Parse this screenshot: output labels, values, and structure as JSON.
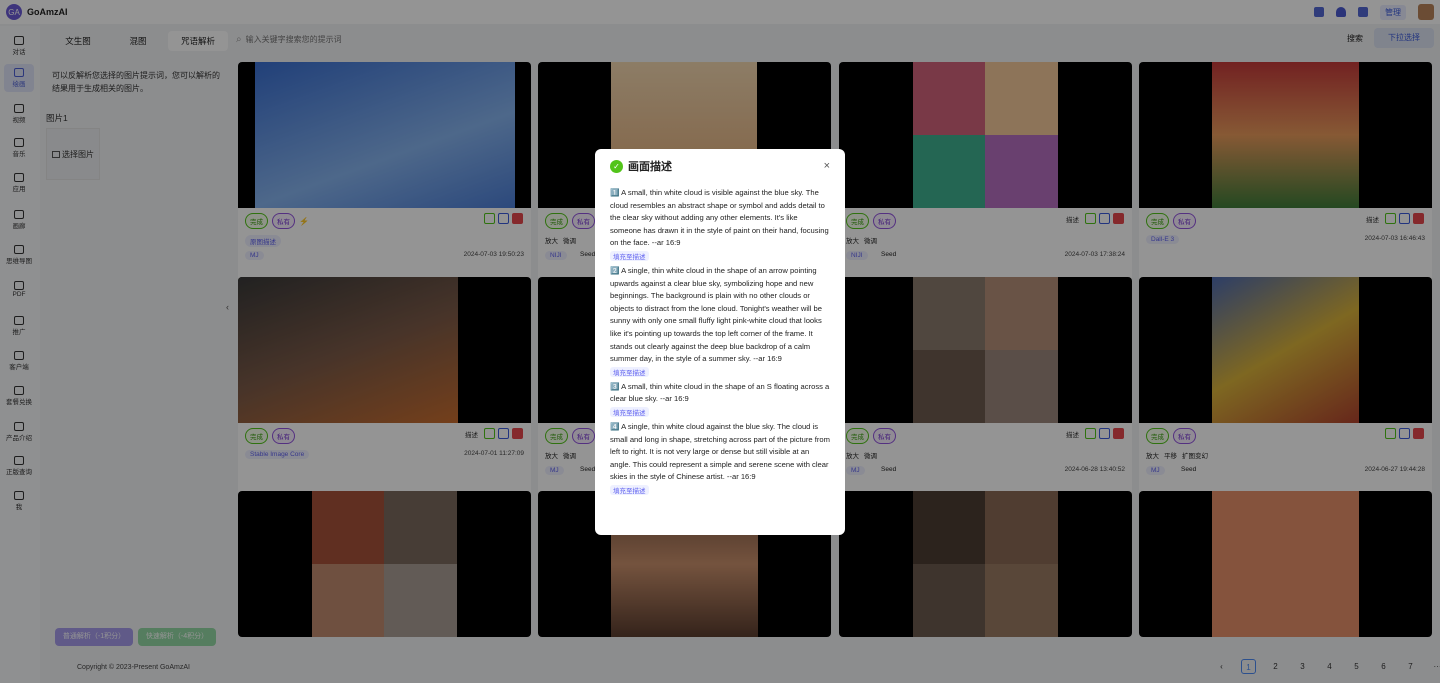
{
  "app": {
    "brand": "GoAmzAI",
    "logo_text": "GA",
    "manage_label": "管理"
  },
  "sidebar": {
    "items": [
      {
        "label": "对话",
        "icon": "chat-icon"
      },
      {
        "label": "绘画",
        "icon": "paint-icon",
        "active": true
      },
      {
        "label": "视频",
        "icon": "video-icon"
      },
      {
        "label": "音乐",
        "icon": "music-icon"
      },
      {
        "label": "应用",
        "icon": "app-icon"
      },
      {
        "label": "画廊",
        "icon": "gallery-icon"
      },
      {
        "label": "思维导图",
        "icon": "mindmap-icon"
      },
      {
        "label": "PDF",
        "icon": "pdf-icon"
      },
      {
        "label": "推广",
        "icon": "promote-icon"
      },
      {
        "label": "客户端",
        "icon": "client-icon"
      },
      {
        "label": "套餐兑换",
        "icon": "diamond-icon"
      },
      {
        "label": "产品介绍",
        "icon": "book-icon"
      },
      {
        "label": "正版查询",
        "icon": "verify-icon"
      },
      {
        "label": "我",
        "icon": "user-icon"
      }
    ]
  },
  "left_panel": {
    "tabs": [
      "文生图",
      "混图",
      "咒语解析"
    ],
    "active_tab": 2,
    "description": "可以反解析您选择的图片提示词，您可以解析的结果用于生成相关的图片。",
    "image_label": "图片1",
    "pick_label": "选择图片",
    "btn_normal": "普通解析（-1积分）",
    "btn_fast": "快速解析（-4积分）",
    "copyright": "Copyright © 2023-Present GoAmzAI",
    "collapse_icon": "chevron-left-icon"
  },
  "search": {
    "placeholder": "输入关键字搜索您的提示词",
    "button": "搜索",
    "dropdown_label": "下拉选择"
  },
  "cards": [
    {
      "status": "完成",
      "privacy": "私有",
      "bolt": true,
      "ctl_text": "",
      "options": [],
      "tag": "原图描述",
      "model": "MJ",
      "seed": "",
      "date": "2024-07-03 19:50:23"
    },
    {
      "status": "完成",
      "privacy": "私有",
      "bolt": false,
      "ctl_text": "",
      "options": [
        "放大",
        "微调"
      ],
      "tag": "",
      "model": "NIJI",
      "seed": "Seed",
      "date": "2024-07-03 17:39:24"
    },
    {
      "status": "完成",
      "privacy": "私有",
      "bolt": false,
      "ctl_text": "描述",
      "options": [
        "放大",
        "微调"
      ],
      "tag": "",
      "model": "NIJI",
      "seed": "Seed",
      "date": "2024-07-03 17:38:24"
    },
    {
      "status": "完成",
      "privacy": "私有",
      "bolt": false,
      "ctl_text": "描述",
      "options": [],
      "tag": "",
      "model": "Dall-E 3",
      "seed": "",
      "date": "2024-07-03 16:46:43"
    },
    {
      "status": "完成",
      "privacy": "私有",
      "bolt": false,
      "ctl_text": "描述",
      "options": [],
      "tag": "",
      "model": "Stable Image Core",
      "seed": "",
      "date": "2024-07-01 11:27:09"
    },
    {
      "status": "完成",
      "privacy": "私有",
      "bolt": false,
      "ctl_text": "",
      "options": [
        "放大",
        "微调"
      ],
      "tag": "",
      "model": "MJ",
      "seed": "Seed",
      "date": "2024-06-28 13:42:18"
    },
    {
      "status": "完成",
      "privacy": "私有",
      "bolt": false,
      "ctl_text": "描述",
      "options": [
        "放大",
        "微调"
      ],
      "tag": "",
      "model": "MJ",
      "seed": "Seed",
      "date": "2024-06-28 13:40:52"
    },
    {
      "status": "完成",
      "privacy": "私有",
      "bolt": false,
      "ctl_text": "",
      "options": [
        "放大",
        "平移",
        "扩图变幻"
      ],
      "tag": "",
      "model": "MJ",
      "seed": "Seed",
      "date": "2024-06-27 19:44:28"
    }
  ],
  "pagination": {
    "pages": [
      "1",
      "2",
      "3",
      "4",
      "5",
      "6",
      "7",
      "···",
      "40"
    ],
    "current": "1",
    "prev": "‹",
    "next": "›"
  },
  "modal": {
    "title": "画面描述",
    "close_icon": "×",
    "fill_label": "填充至描述",
    "items": [
      "1️⃣ A small, thin white cloud is visible against the blue sky. The cloud resembles an abstract shape or symbol and adds detail to the clear sky without adding any other elements. It's like someone has drawn it in the style of paint on their hand, focusing on the face. --ar 16:9",
      "2️⃣ A single, thin white cloud in the shape of an arrow pointing upwards against a clear blue sky, symbolizing hope and new beginnings. The background is plain with no other clouds or objects to distract from the lone cloud. Tonight's weather will be sunny with only one small fluffy light pink-white cloud that looks like it's pointing up towards the top left corner of the frame. It stands out clearly against the deep blue backdrop of a calm summer day, in the style of a summer sky. --ar 16:9",
      "3️⃣ A small, thin white cloud in the shape of an S floating across a clear blue sky. --ar 16:9",
      "4️⃣ A single, thin white cloud against the blue sky. The cloud is small and long in shape, stretching across part of the picture from left to right. It is not very large or dense but still visible at an angle. This could represent a simple and serene scene with clear skies in the style of Chinese artist. --ar 16:9"
    ]
  }
}
